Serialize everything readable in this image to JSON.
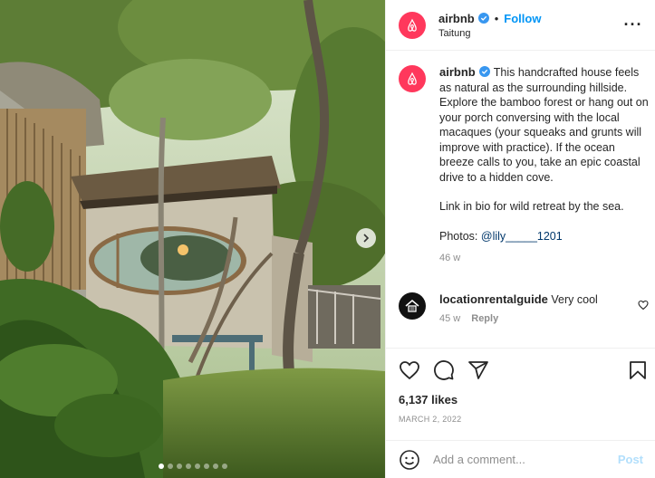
{
  "photo": {
    "slide_count": 8,
    "active_slide": 1,
    "next_icon": "chevron-right-icon"
  },
  "header": {
    "username": "airbnb",
    "separator": "•",
    "follow_label": "Follow",
    "location": "Taitung",
    "more_icon": "ellipsis-icon",
    "logo_color": "#ff385c"
  },
  "caption": {
    "username": "airbnb",
    "text_1": "This handcrafted house feels as natural as the surrounding hillside. Explore the bamboo forest or hang out on your porch conversing with the local macaques (your squeaks and grunts will improve with practice). If the ocean breeze calls to you, take an epic coastal drive to a hidden cove.",
    "text_2": "Link in bio for wild retreat by the sea.",
    "photos_label": "Photos: ",
    "photos_mention": "@lily_____1201",
    "time": "46 w"
  },
  "comment": {
    "username": "locationrentalguide",
    "text": "Very cool",
    "time": "45 w",
    "reply_label": "Reply"
  },
  "actions": {
    "like_icon": "heart-icon",
    "comment_icon": "comment-icon",
    "share_icon": "share-icon",
    "save_icon": "bookmark-icon"
  },
  "likes": "6,137 likes",
  "date": "MARCH 2, 2022",
  "add_comment": {
    "placeholder": "Add a comment...",
    "post_label": "Post",
    "emoji_icon": "smiley-icon"
  },
  "colors": {
    "accent": "#0095f6",
    "brand": "#ff385c",
    "muted": "#8e8e8e"
  }
}
